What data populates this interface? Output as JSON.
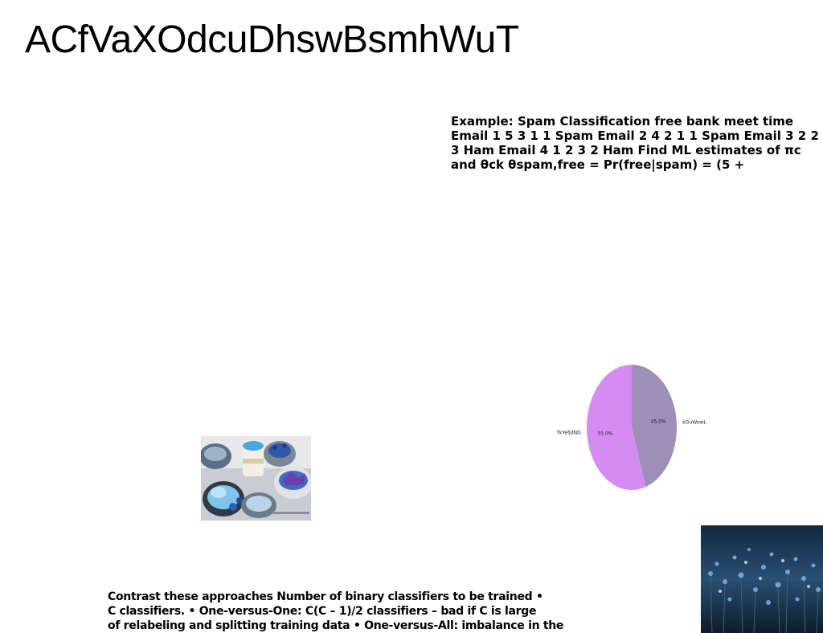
{
  "title": "ACfVaXOdcuDhswBsmhWuT",
  "text_block_1": "Example: Spam Classification free bank meet time Email 1 5 3 1 1 Spam Email 2 4 2 1 1 Spam Email 3 2 2 3 Ham Email 4 1 2 3 2 Ham Find ML estimates of πc and θck θspam,free = Pr(free|spam) = (5 +",
  "text_block_2_lines": [
    "Contrast these approaches Number of binary classifiers to be trained •",
    "C classifiers. • One-versus-One: C(C – 1)/2 classifiers – bad if C is large",
    "of relabeling and splitting training data • One-versus-All: imbalance in the"
  ],
  "chart_data": {
    "type": "pie",
    "categories": [
      "kOuWowL",
      "TkYefjdND"
    ],
    "values": [
      45.0,
      55.0
    ],
    "labels_pct": [
      "45.0%",
      "55.0%"
    ],
    "colors": [
      "#9e8fb8",
      "#d58cf2"
    ],
    "start": "top",
    "direction": "clockwise",
    "title": ""
  },
  "images": {
    "food_photo": "blue-desserts-photo",
    "flower_photo": "blue-flowers-photo"
  }
}
